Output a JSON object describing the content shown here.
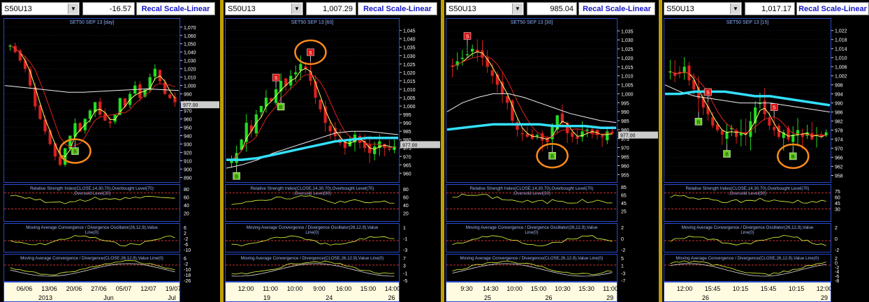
{
  "panels": [
    {
      "symbol": "S50U13",
      "value": "-16.57",
      "recal": "Recal Scale-Linear",
      "chart_data": {
        "type": "candlestick",
        "title": "SET50 SEP 13",
        "interval": "[day]",
        "yticks": [
          "1,070",
          "1,060",
          "1,050",
          "1,040",
          "1,030",
          "1,020",
          "1,010",
          "1,000",
          "990",
          "980",
          "970",
          "960",
          "950",
          "940",
          "930",
          "920",
          "910",
          "900",
          "890"
        ],
        "ylim": [
          887,
          1074
        ],
        "current_price_label": "977.00",
        "current_price": 977,
        "rsi_label": "Relative Strength Index(CLOSE,14,30,70),Overbought Level(70),Oversold Level(30)",
        "rsi_ticks": [
          "80",
          "60",
          "40",
          "20"
        ],
        "macd_osc_label": "Moving Average Convergence / Divergence Oscillator(26,12,9),Value Line(0)",
        "macd_osc_ticks": [
          "6",
          "2",
          "-2",
          "-6",
          "-10"
        ],
        "macd_label": "Moving Average Convergence / Divergence(CLOSE,26,12,9),Value Line(0)",
        "macd_ticks": [
          "6",
          "-2",
          "-10",
          "-18",
          "-26"
        ],
        "x_labels": [
          "06/06",
          "13/06",
          "20/06",
          "27/06",
          "05/07",
          "12/07",
          "19/07"
        ],
        "x_labels_2": [
          "2013",
          "Jun",
          "Jul"
        ],
        "signals": [
          {
            "type": "B",
            "x_index": 13
          }
        ],
        "circled_index": 13
      }
    },
    {
      "symbol": "S50U13",
      "value": "1,007.29",
      "recal": "Recal Scale-Linear",
      "chart_data": {
        "type": "candlestick",
        "title": "SET50 SEP 13",
        "interval": "[60]",
        "yticks": [
          "1,045",
          "1,040",
          "1,035",
          "1,030",
          "1,025",
          "1,020",
          "1,015",
          "1,010",
          "1,005",
          "1,000",
          "995",
          "990",
          "985",
          "980",
          "975",
          "970",
          "965",
          "960"
        ],
        "ylim": [
          956,
          1049
        ],
        "current_price_label": "977.00",
        "current_price": 977,
        "rsi_label": "Relative Strength Index(CLOSE,14,30,70),Overbought Level(70),Oversold Level(30)",
        "rsi_ticks": [
          "80",
          "60",
          "40",
          "20"
        ],
        "macd_osc_label": "Moving Average Convergence / Divergence Oscillator(26,12,9),Value Line(0)",
        "macd_osc_ticks": [
          "1",
          "-1",
          "-3"
        ],
        "macd_label": "Moving Average Convergence / Divergence(CLOSE,26,12,9),Value Line(0)",
        "macd_ticks": [
          "7",
          "3",
          "-1",
          "-5"
        ],
        "x_labels": [
          "12:00",
          "11:00",
          "10:00",
          "9:00",
          "16:00",
          "15:00",
          "14:00"
        ],
        "x_labels_2": [
          "19",
          "24",
          "26"
        ],
        "signals": [
          {
            "type": "B"
          },
          {
            "type": "S"
          },
          {
            "type": "B"
          },
          {
            "type": "S"
          }
        ],
        "circled_index": 3
      }
    },
    {
      "symbol": "S50U13",
      "value": "985.04",
      "recal": "Recal Scale-Linear",
      "chart_data": {
        "type": "candlestick",
        "title": "SET50 SEP 13",
        "interval": "[30]",
        "yticks": [
          "1,035",
          "1,030",
          "1,025",
          "1,020",
          "1,015",
          "1,010",
          "1,005",
          "1,000",
          "995",
          "990",
          "985",
          "980",
          "975",
          "970",
          "965",
          "960",
          "955"
        ],
        "ylim": [
          952,
          1039
        ],
        "current_price_label": "977.00",
        "current_price": 977,
        "rsi_label": "Relative Strength Index(CLOSE,14,30,70),Overbought Level(70),Oversold Level(30)",
        "rsi_ticks": [
          "85",
          "65",
          "45",
          "25"
        ],
        "macd_osc_label": "Moving Average Convergence / Divergence Oscillator(26,12,9),Value Line(0)",
        "macd_osc_ticks": [
          "2",
          "0",
          "-2"
        ],
        "macd_label": "Moving Average Convergence / Divergence(CLOSE,26,12,9),Value Line(0)",
        "macd_ticks": [
          "5",
          "1",
          "-3",
          "-7"
        ],
        "x_labels": [
          "9:30",
          "14:30",
          "10:00",
          "15:00",
          "10:30",
          "15:30",
          "11:00"
        ],
        "x_labels_2": [
          "25",
          "26",
          "29"
        ],
        "signals": [
          {
            "type": "S"
          },
          {
            "type": "B"
          }
        ],
        "circled_index": 1
      }
    },
    {
      "symbol": "S50U13",
      "value": "1,017.17",
      "recal": "Recal Scale-Linear",
      "chart_data": {
        "type": "candlestick",
        "title": "SET50 SEP 13",
        "interval": "[15]",
        "yticks": [
          "1,022",
          "1,018",
          "1,014",
          "1,010",
          "1,006",
          "1,002",
          "998",
          "994",
          "990",
          "986",
          "982",
          "978",
          "974",
          "970",
          "966",
          "962",
          "958"
        ],
        "ylim": [
          956,
          1025
        ],
        "current_price_label": "",
        "current_price": 977,
        "rsi_label": "Relative Strength Index(CLOSE,14,30,70),Overbought Level(70),Oversold Level(30)",
        "rsi_ticks": [
          "75",
          "60",
          "45",
          "30"
        ],
        "macd_osc_label": "Moving Average Convergence / Divergence Oscillator(26,12,9),Value Line(0)",
        "macd_osc_ticks": [
          "2",
          "0",
          "-2"
        ],
        "macd_label": "Moving Average Convergence / Divergence(CLOSE,26,12,9),Value Line(0)",
        "macd_ticks": [
          "2",
          "0",
          "-2",
          "-4",
          "-6",
          "-8"
        ],
        "x_labels": [
          "12:00",
          "15:45",
          "10:15",
          "15:45",
          "10:15",
          "12:00"
        ],
        "x_labels_2": [
          "26",
          "29"
        ],
        "signals": [
          {
            "type": "B"
          },
          {
            "type": "S"
          },
          {
            "type": "B"
          },
          {
            "type": "S"
          },
          {
            "type": "B"
          }
        ],
        "circled_index": 4
      }
    }
  ]
}
